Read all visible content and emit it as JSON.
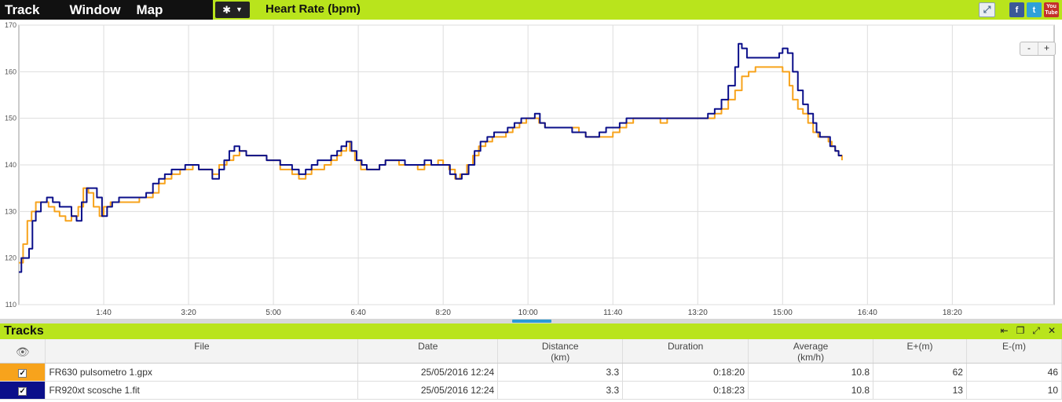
{
  "menu": {
    "items": [
      "Track",
      "Window",
      "Map"
    ]
  },
  "toolbar": {
    "gear_icon": "gear-icon",
    "caret_icon": "chevron-down-icon"
  },
  "chart_title": "Heart Rate (bpm)",
  "zoom": {
    "minus": "-",
    "plus": "+"
  },
  "social": {
    "facebook": "f",
    "twitter": "t",
    "youtube_top": "You",
    "youtube_bottom": "Tube"
  },
  "colors": {
    "accent": "#b9e41c",
    "series1": "#f7a31c",
    "series2": "#0b0f8a"
  },
  "chart_data": {
    "type": "line",
    "ylim": [
      110,
      170
    ],
    "yticks": [
      110,
      120,
      130,
      140,
      150,
      160,
      170
    ],
    "xlim": [
      0,
      1220
    ],
    "xticks": [
      {
        "v": 100,
        "label": "1:40"
      },
      {
        "v": 200,
        "label": "3:20"
      },
      {
        "v": 300,
        "label": "5:00"
      },
      {
        "v": 400,
        "label": "6:40"
      },
      {
        "v": 500,
        "label": "8:20"
      },
      {
        "v": 600,
        "label": "10:00"
      },
      {
        "v": 700,
        "label": "11:40"
      },
      {
        "v": 800,
        "label": "13:20"
      },
      {
        "v": 900,
        "label": "15:00"
      },
      {
        "v": 1000,
        "label": "16:40"
      },
      {
        "v": 1100,
        "label": "18:20"
      }
    ],
    "grid": true,
    "series": [
      {
        "color": "#f7a31c",
        "points": [
          [
            0,
            119
          ],
          [
            5,
            123
          ],
          [
            10,
            128
          ],
          [
            15,
            130
          ],
          [
            20,
            132
          ],
          [
            28,
            132
          ],
          [
            35,
            131
          ],
          [
            42,
            130
          ],
          [
            48,
            129
          ],
          [
            55,
            128
          ],
          [
            62,
            129
          ],
          [
            70,
            131
          ],
          [
            76,
            135
          ],
          [
            82,
            134
          ],
          [
            88,
            131
          ],
          [
            95,
            129
          ],
          [
            100,
            131
          ],
          [
            108,
            132
          ],
          [
            118,
            132
          ],
          [
            128,
            132
          ],
          [
            135,
            132
          ],
          [
            142,
            133
          ],
          [
            150,
            133
          ],
          [
            158,
            134
          ],
          [
            165,
            136
          ],
          [
            172,
            137
          ],
          [
            180,
            138
          ],
          [
            190,
            139
          ],
          [
            198,
            139
          ],
          [
            205,
            140
          ],
          [
            212,
            139
          ],
          [
            220,
            139
          ],
          [
            228,
            138
          ],
          [
            236,
            140
          ],
          [
            245,
            141
          ],
          [
            253,
            142
          ],
          [
            260,
            143
          ],
          [
            268,
            142
          ],
          [
            276,
            142
          ],
          [
            285,
            142
          ],
          [
            292,
            141
          ],
          [
            300,
            141
          ],
          [
            308,
            139
          ],
          [
            316,
            139
          ],
          [
            322,
            138
          ],
          [
            330,
            137
          ],
          [
            338,
            138
          ],
          [
            345,
            139
          ],
          [
            352,
            139
          ],
          [
            360,
            140
          ],
          [
            368,
            141
          ],
          [
            375,
            142
          ],
          [
            380,
            143
          ],
          [
            386,
            145
          ],
          [
            390,
            143
          ],
          [
            396,
            141
          ],
          [
            403,
            139
          ],
          [
            410,
            139
          ],
          [
            418,
            139
          ],
          [
            425,
            140
          ],
          [
            432,
            141
          ],
          [
            440,
            141
          ],
          [
            448,
            140
          ],
          [
            455,
            140
          ],
          [
            462,
            140
          ],
          [
            470,
            139
          ],
          [
            478,
            140
          ],
          [
            486,
            140
          ],
          [
            494,
            141
          ],
          [
            500,
            140
          ],
          [
            507,
            139
          ],
          [
            514,
            137
          ],
          [
            520,
            138
          ],
          [
            528,
            140
          ],
          [
            535,
            142
          ],
          [
            542,
            144
          ],
          [
            550,
            145
          ],
          [
            558,
            146
          ],
          [
            566,
            146
          ],
          [
            574,
            147
          ],
          [
            582,
            148
          ],
          [
            590,
            149
          ],
          [
            598,
            150
          ],
          [
            606,
            150
          ],
          [
            613,
            149
          ],
          [
            620,
            148
          ],
          [
            628,
            148
          ],
          [
            636,
            148
          ],
          [
            644,
            148
          ],
          [
            652,
            148
          ],
          [
            660,
            147
          ],
          [
            668,
            146
          ],
          [
            676,
            146
          ],
          [
            684,
            146
          ],
          [
            692,
            146
          ],
          [
            700,
            147
          ],
          [
            708,
            148
          ],
          [
            716,
            149
          ],
          [
            724,
            150
          ],
          [
            732,
            150
          ],
          [
            740,
            150
          ],
          [
            748,
            150
          ],
          [
            756,
            149
          ],
          [
            764,
            150
          ],
          [
            772,
            150
          ],
          [
            780,
            150
          ],
          [
            788,
            150
          ],
          [
            796,
            150
          ],
          [
            804,
            150
          ],
          [
            812,
            150
          ],
          [
            820,
            151
          ],
          [
            828,
            152
          ],
          [
            836,
            154
          ],
          [
            844,
            156
          ],
          [
            852,
            159
          ],
          [
            860,
            160
          ],
          [
            868,
            161
          ],
          [
            876,
            161
          ],
          [
            884,
            161
          ],
          [
            892,
            161
          ],
          [
            900,
            160
          ],
          [
            908,
            157
          ],
          [
            912,
            154
          ],
          [
            918,
            152
          ],
          [
            924,
            151
          ],
          [
            930,
            149
          ],
          [
            936,
            147
          ],
          [
            942,
            146
          ],
          [
            948,
            146
          ],
          [
            954,
            145
          ],
          [
            958,
            144
          ],
          [
            962,
            143
          ],
          [
            966,
            142
          ],
          [
            970,
            141
          ]
        ]
      },
      {
        "color": "#0b0f8a",
        "points": [
          [
            0,
            117
          ],
          [
            3,
            120
          ],
          [
            8,
            120
          ],
          [
            12,
            122
          ],
          [
            16,
            128
          ],
          [
            20,
            130
          ],
          [
            26,
            132
          ],
          [
            33,
            133
          ],
          [
            40,
            132
          ],
          [
            48,
            131
          ],
          [
            55,
            131
          ],
          [
            62,
            129
          ],
          [
            68,
            128
          ],
          [
            74,
            132
          ],
          [
            80,
            135
          ],
          [
            86,
            135
          ],
          [
            92,
            133
          ],
          [
            98,
            129
          ],
          [
            104,
            131
          ],
          [
            110,
            132
          ],
          [
            118,
            133
          ],
          [
            126,
            133
          ],
          [
            134,
            133
          ],
          [
            142,
            133
          ],
          [
            150,
            134
          ],
          [
            158,
            136
          ],
          [
            165,
            137
          ],
          [
            172,
            138
          ],
          [
            180,
            139
          ],
          [
            188,
            139
          ],
          [
            196,
            140
          ],
          [
            204,
            140
          ],
          [
            212,
            139
          ],
          [
            220,
            139
          ],
          [
            228,
            137
          ],
          [
            236,
            139
          ],
          [
            242,
            141
          ],
          [
            248,
            143
          ],
          [
            254,
            144
          ],
          [
            260,
            143
          ],
          [
            268,
            142
          ],
          [
            276,
            142
          ],
          [
            285,
            142
          ],
          [
            292,
            141
          ],
          [
            300,
            141
          ],
          [
            308,
            140
          ],
          [
            316,
            140
          ],
          [
            322,
            139
          ],
          [
            330,
            138
          ],
          [
            338,
            139
          ],
          [
            345,
            140
          ],
          [
            352,
            141
          ],
          [
            360,
            141
          ],
          [
            368,
            142
          ],
          [
            375,
            143
          ],
          [
            380,
            144
          ],
          [
            386,
            145
          ],
          [
            392,
            143
          ],
          [
            398,
            141
          ],
          [
            404,
            140
          ],
          [
            410,
            139
          ],
          [
            418,
            139
          ],
          [
            425,
            140
          ],
          [
            432,
            141
          ],
          [
            440,
            141
          ],
          [
            448,
            141
          ],
          [
            455,
            140
          ],
          [
            462,
            140
          ],
          [
            470,
            140
          ],
          [
            478,
            141
          ],
          [
            486,
            140
          ],
          [
            494,
            140
          ],
          [
            500,
            140
          ],
          [
            508,
            138
          ],
          [
            515,
            137
          ],
          [
            522,
            138
          ],
          [
            530,
            140
          ],
          [
            537,
            143
          ],
          [
            544,
            145
          ],
          [
            552,
            146
          ],
          [
            560,
            147
          ],
          [
            568,
            147
          ],
          [
            576,
            148
          ],
          [
            584,
            149
          ],
          [
            592,
            150
          ],
          [
            600,
            150
          ],
          [
            608,
            151
          ],
          [
            614,
            149
          ],
          [
            620,
            148
          ],
          [
            628,
            148
          ],
          [
            636,
            148
          ],
          [
            644,
            148
          ],
          [
            652,
            147
          ],
          [
            660,
            147
          ],
          [
            668,
            146
          ],
          [
            676,
            146
          ],
          [
            684,
            147
          ],
          [
            692,
            148
          ],
          [
            700,
            148
          ],
          [
            708,
            149
          ],
          [
            716,
            150
          ],
          [
            724,
            150
          ],
          [
            732,
            150
          ],
          [
            740,
            150
          ],
          [
            748,
            150
          ],
          [
            756,
            150
          ],
          [
            764,
            150
          ],
          [
            772,
            150
          ],
          [
            780,
            150
          ],
          [
            788,
            150
          ],
          [
            796,
            150
          ],
          [
            804,
            150
          ],
          [
            812,
            151
          ],
          [
            820,
            152
          ],
          [
            828,
            154
          ],
          [
            836,
            157
          ],
          [
            844,
            161
          ],
          [
            848,
            166
          ],
          [
            852,
            165
          ],
          [
            858,
            163
          ],
          [
            866,
            163
          ],
          [
            874,
            163
          ],
          [
            882,
            163
          ],
          [
            890,
            163
          ],
          [
            896,
            164
          ],
          [
            900,
            165
          ],
          [
            906,
            164
          ],
          [
            912,
            160
          ],
          [
            918,
            156
          ],
          [
            924,
            153
          ],
          [
            930,
            151
          ],
          [
            936,
            149
          ],
          [
            940,
            147
          ],
          [
            944,
            146
          ],
          [
            950,
            146
          ],
          [
            956,
            144
          ],
          [
            962,
            143
          ],
          [
            966,
            142
          ],
          [
            970,
            142
          ]
        ]
      }
    ]
  },
  "tracks": {
    "title": "Tracks",
    "controls": [
      "⇤",
      "❐",
      "⤢",
      "✕"
    ],
    "columns": [
      {
        "key": "file",
        "label": "File",
        "sub": ""
      },
      {
        "key": "date",
        "label": "Date",
        "sub": ""
      },
      {
        "key": "distance",
        "label": "Distance",
        "sub": "(km)"
      },
      {
        "key": "duration",
        "label": "Duration",
        "sub": ""
      },
      {
        "key": "average",
        "label": "Average",
        "sub": "(km/h)"
      },
      {
        "key": "eplus",
        "label": "E+(m)",
        "sub": ""
      },
      {
        "key": "eminus",
        "label": "E-(m)",
        "sub": ""
      }
    ],
    "rows": [
      {
        "color": "#f7a31c",
        "checked": "✓",
        "file": "FR630 pulsometro 1.gpx",
        "date": "25/05/2016 12:24",
        "distance": "3.3",
        "duration": "0:18:20",
        "average": "10.8",
        "eplus": "62",
        "eminus": "46"
      },
      {
        "color": "#0b0f8a",
        "checked": "✓",
        "file": "FR920xt scosche 1.fit",
        "date": "25/05/2016 12:24",
        "distance": "3.3",
        "duration": "0:18:23",
        "average": "10.8",
        "eplus": "13",
        "eminus": "10"
      }
    ]
  }
}
